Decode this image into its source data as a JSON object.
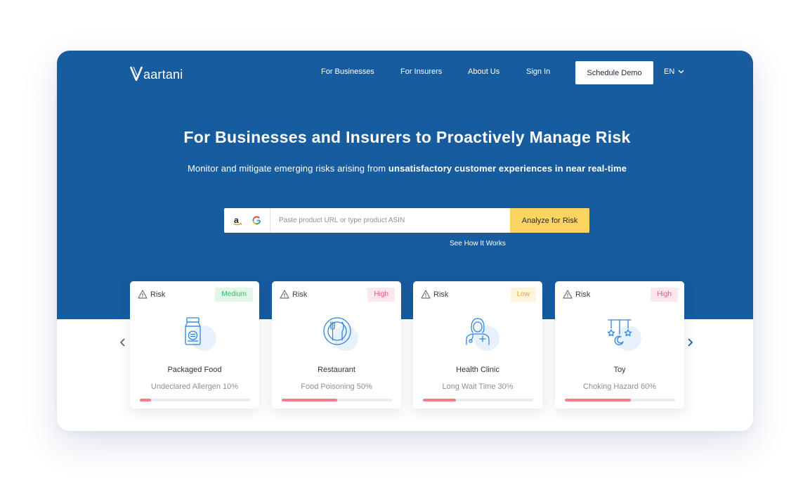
{
  "brand": {
    "logo_text": "aartani"
  },
  "nav": {
    "for_businesses": "For Businesses",
    "for_insurers": "For Insurers",
    "about_us": "About Us",
    "sign_in": "Sign In",
    "schedule_demo": "Schedule Demo",
    "language": "EN"
  },
  "hero": {
    "headline": "For Businesses and Insurers to Proactively Manage Risk",
    "subhead_plain": "Monitor and mitigate emerging risks arising from ",
    "subhead_bold": "unsatisfactory customer experiences in near real-time"
  },
  "search": {
    "source_icons": [
      "amazon-icon",
      "google-icon"
    ],
    "placeholder": "Paste product URL or type product ASIN",
    "value": "",
    "analyze_label": "Analyze for Risk",
    "how_link": "See How It Works"
  },
  "cards": [
    {
      "risk_label": "Risk",
      "level": "Medium",
      "level_key": "medium",
      "icon": "packaged-food-icon",
      "title": "Packaged Food",
      "detail": "Undeclared Allergen 10%",
      "percent": 10
    },
    {
      "risk_label": "Risk",
      "level": "High",
      "level_key": "high",
      "icon": "restaurant-icon",
      "title": "Restaurant",
      "detail": "Food Poisoning 50%",
      "percent": 50
    },
    {
      "risk_label": "Risk",
      "level": "Low",
      "level_key": "low",
      "icon": "health-clinic-icon",
      "title": "Health Clinic",
      "detail": "Long Wait Time 30%",
      "percent": 30
    },
    {
      "risk_label": "Risk",
      "level": "High",
      "level_key": "high",
      "icon": "toy-icon",
      "title": "Toy",
      "detail": "Choking Hazard  60%",
      "percent": 60
    }
  ],
  "colors": {
    "hero_blue": "#175c9f",
    "cta_yellow": "#fcd462",
    "progress_red": "#ee7f88",
    "icon_blue": "#2b87e3",
    "medium_green": "#36b36a",
    "high_pink": "#e0567a",
    "low_orange": "#e3a73b"
  }
}
